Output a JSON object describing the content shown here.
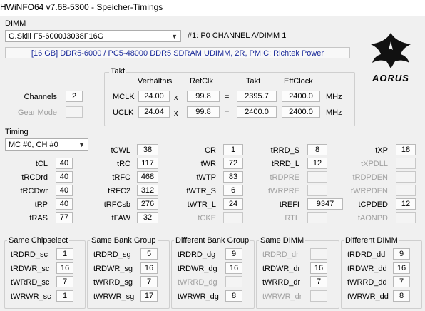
{
  "window": {
    "title": "HWiNFO64 v7.68-5300 - Speicher-Timings"
  },
  "dimm": {
    "section_label": "DIMM",
    "selected_module": "G.Skill F5-6000J3038F16G",
    "slot_info": "#1: P0 CHANNEL A/DIMM 1",
    "description": "[16 GB] DDR5-6000 / PC5-48000 DDR5 SDRAM UDIMM, 2R, PMIC: Richtek Power",
    "logo_text": "AORUS"
  },
  "channels": {
    "label": "Channels",
    "value": "2"
  },
  "gear_mode": {
    "label": "Gear Mode",
    "value": ""
  },
  "takt": {
    "section_label": "Takt",
    "headers": {
      "ratio": "Verhältnis",
      "refclk": "RefClk",
      "takt": "Takt",
      "effclock": "EffClock"
    },
    "mclk": {
      "label": "MCLK",
      "ratio": "24.00",
      "x": "x",
      "refclk": "99.8",
      "eq": "=",
      "takt": "2395.7",
      "eff": "2400.0",
      "unit": "MHz"
    },
    "uclk": {
      "label": "UCLK",
      "ratio": "24.04",
      "x": "x",
      "refclk": "99.8",
      "eq": "=",
      "takt": "2400.0",
      "eff": "2400.0",
      "unit": "MHz"
    }
  },
  "timing": {
    "section_label": "Timing",
    "channel_select": "MC #0, CH #0",
    "cells": [
      {
        "label": "tCL",
        "value": "40"
      },
      {
        "label": "tRCDrd",
        "value": "40"
      },
      {
        "label": "tRCDwr",
        "value": "40"
      },
      {
        "label": "tRP",
        "value": "40"
      },
      {
        "label": "tRAS",
        "value": "77"
      },
      {
        "label": "tCWL",
        "value": "38"
      },
      {
        "label": "tRC",
        "value": "117"
      },
      {
        "label": "tRFC",
        "value": "468"
      },
      {
        "label": "tRFC2",
        "value": "312"
      },
      {
        "label": "tRFCsb",
        "value": "276"
      },
      {
        "label": "tFAW",
        "value": "32"
      },
      {
        "label": "CR",
        "value": "1"
      },
      {
        "label": "tWR",
        "value": "72"
      },
      {
        "label": "tWTP",
        "value": "83"
      },
      {
        "label": "tWTR_S",
        "value": "6"
      },
      {
        "label": "tWTR_L",
        "value": "24"
      },
      {
        "label": "tCKE",
        "value": ""
      },
      {
        "label": "tRRD_S",
        "value": "8"
      },
      {
        "label": "tRRD_L",
        "value": "12"
      },
      {
        "label": "tRDPRE",
        "value": ""
      },
      {
        "label": "tWRPRE",
        "value": ""
      },
      {
        "label": "tREFI",
        "value": "9347"
      },
      {
        "label": "RTL",
        "value": ""
      },
      {
        "label": "tXP",
        "value": "18"
      },
      {
        "label": "tXPDLL",
        "value": ""
      },
      {
        "label": "tRDPDEN",
        "value": ""
      },
      {
        "label": "tWRPDEN",
        "value": ""
      },
      {
        "label": "tCPDED",
        "value": "12"
      },
      {
        "label": "tAONPD",
        "value": ""
      }
    ]
  },
  "groups": [
    {
      "title": "Same Chipselect",
      "rows": [
        {
          "label": "tRDRD_sc",
          "value": "1"
        },
        {
          "label": "tRDWR_sc",
          "value": "16"
        },
        {
          "label": "tWRRD_sc",
          "value": "7"
        },
        {
          "label": "tWRWR_sc",
          "value": "1"
        }
      ]
    },
    {
      "title": "Same Bank Group",
      "rows": [
        {
          "label": "tRDRD_sg",
          "value": "5"
        },
        {
          "label": "tRDWR_sg",
          "value": "16"
        },
        {
          "label": "tWRRD_sg",
          "value": "7"
        },
        {
          "label": "tWRWR_sg",
          "value": "17"
        }
      ]
    },
    {
      "title": "Different Bank Group",
      "rows": [
        {
          "label": "tRDRD_dg",
          "value": "9"
        },
        {
          "label": "tRDWR_dg",
          "value": "16"
        },
        {
          "label": "tWRRD_dg",
          "value": ""
        },
        {
          "label": "tWRWR_dg",
          "value": "8"
        }
      ]
    },
    {
      "title": "Same DIMM",
      "rows": [
        {
          "label": "tRDRD_dr",
          "value": ""
        },
        {
          "label": "tRDWR_dr",
          "value": "16"
        },
        {
          "label": "tWRRD_dr",
          "value": "7"
        },
        {
          "label": "tWRWR_dr",
          "value": ""
        }
      ]
    },
    {
      "title": "Different DIMM",
      "rows": [
        {
          "label": "tRDRD_dd",
          "value": "9"
        },
        {
          "label": "tRDWR_dd",
          "value": "16"
        },
        {
          "label": "tWRRD_dd",
          "value": "7"
        },
        {
          "label": "tWRWR_dd",
          "value": "8"
        }
      ]
    }
  ]
}
